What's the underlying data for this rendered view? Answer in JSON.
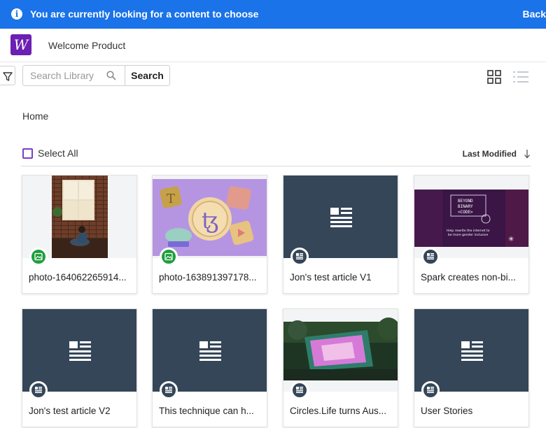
{
  "banner": {
    "message": "You are currently looking for a content to choose",
    "back": "Back"
  },
  "header": {
    "logo_letter": "W",
    "product": "Welcome Product"
  },
  "toolbar": {
    "search_placeholder": "Search Library",
    "search_button": "Search"
  },
  "breadcrumb": "Home",
  "list_header": {
    "select_all": "Select All",
    "sort_label": "Last Modified"
  },
  "colors": {
    "banner": "#1a73e8",
    "accent": "#7b3fc4",
    "article_bg": "#344658",
    "image_badge": "#1e9e3d"
  },
  "cards": [
    {
      "title": "photo-164062265914...",
      "type": "image",
      "icon": "image-icon"
    },
    {
      "title": "photo-163891397178...",
      "type": "image",
      "icon": "image-icon"
    },
    {
      "title": "Jon's test article V1",
      "type": "article",
      "icon": "article-icon"
    },
    {
      "title": "Spark creates non-bi...",
      "type": "article",
      "icon": "article-icon",
      "thumb_text": [
        "BEYOND",
        "BINARY",
        "<CODE>",
        "Help rewrite the internet to",
        "be more gender inclusive"
      ]
    },
    {
      "title": "Jon's test article V2",
      "type": "article",
      "icon": "article-icon"
    },
    {
      "title": "This technique can h...",
      "type": "article",
      "icon": "article-icon"
    },
    {
      "title": "Circles.Life turns Aus...",
      "type": "article",
      "icon": "article-icon"
    },
    {
      "title": "User Stories",
      "type": "article",
      "icon": "article-icon"
    }
  ]
}
